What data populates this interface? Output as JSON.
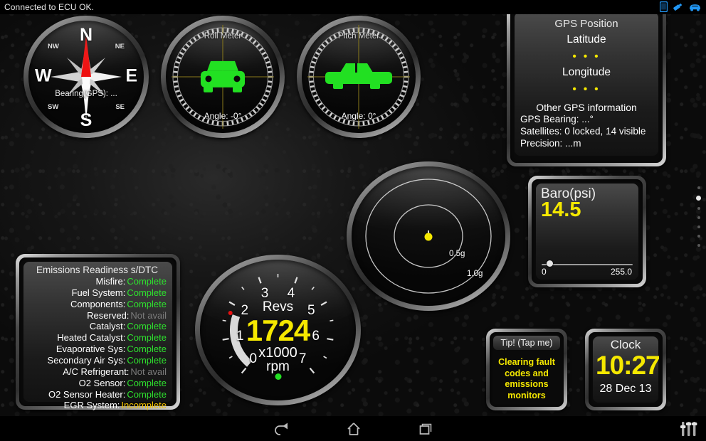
{
  "statusbar": {
    "message": "Connected to ECU OK.",
    "icons": [
      "tablet-icon",
      "usb-icon",
      "car-icon"
    ]
  },
  "compass": {
    "name": "Compass",
    "north": "N",
    "south": "S",
    "east": "E",
    "west": "W",
    "ne": "NE",
    "nw": "NW",
    "se": "SE",
    "sw": "SW",
    "bearing": "Bearing(GPS): ..."
  },
  "roll_meter": {
    "title": "Roll Meter",
    "angle": "Angle: -0°",
    "icon": "car-front-icon"
  },
  "pitch_meter": {
    "title": "Pitch Meter",
    "angle": "Angle: 0°",
    "icon": "car-side-icon"
  },
  "gps": {
    "title": "GPS Position",
    "latitude_label": "Latitude",
    "latitude_value": "• • •",
    "longitude_label": "Longitude",
    "longitude_value": "• • •",
    "other_title": "Other GPS information",
    "bearing": "GPS Bearing: ...°",
    "satellites": "Satellites: 0 locked, 14 visible",
    "precision": "Precision: ...m"
  },
  "baro": {
    "title": "Baro(psi)",
    "value": "14.5",
    "min": "0",
    "max": "255.0",
    "knob_percent": 5.7
  },
  "gmeter": {
    "name": "G-Force Meter",
    "ring_inner_label": "0.5g",
    "ring_outer_label": "1.0g"
  },
  "tacho": {
    "name": "Revs",
    "value": "1724",
    "unit_top": "x1000",
    "unit_bottom": "rpm",
    "ticks": [
      "0",
      "1",
      "2",
      "3",
      "4",
      "5",
      "6",
      "7"
    ],
    "arc_value": 1.724,
    "arc_max": 7
  },
  "emissions": {
    "title": "Emissions Readiness s/DTC",
    "rows": [
      {
        "key": "Misfire:",
        "value": "Complete",
        "state": "complete"
      },
      {
        "key": "Fuel System:",
        "value": "Complete",
        "state": "complete"
      },
      {
        "key": "Components:",
        "value": "Complete",
        "state": "complete"
      },
      {
        "key": "Reserved:",
        "value": "Not avail",
        "state": "notavail"
      },
      {
        "key": "Catalyst:",
        "value": "Complete",
        "state": "complete"
      },
      {
        "key": "Heated Catalyst:",
        "value": "Complete",
        "state": "complete"
      },
      {
        "key": "Evaporative Sys:",
        "value": "Complete",
        "state": "complete"
      },
      {
        "key": "Secondary Air Sys:",
        "value": "Complete",
        "state": "complete"
      },
      {
        "key": "A/C Refrigerant:",
        "value": "Not avail",
        "state": "notavail"
      },
      {
        "key": "O2 Sensor:",
        "value": "Complete",
        "state": "complete"
      },
      {
        "key": "O2 Sensor Heater:",
        "value": "Complete",
        "state": "complete"
      },
      {
        "key": "EGR System:",
        "value": "Incomplete",
        "state": "incomplete"
      }
    ]
  },
  "tip": {
    "header": "Tip! (Tap me)",
    "body": "Clearing fault codes and emissions monitors"
  },
  "clock": {
    "title": "Clock",
    "time": "10:27",
    "date": "28 Dec 13"
  },
  "pager": {
    "count": 7,
    "active_index": 1
  },
  "navbar": {
    "back": "back-icon",
    "home": "home-icon",
    "recents": "recents-icon",
    "settings": "equalizer-icon"
  },
  "colors": {
    "accent_yellow": "#f5e800",
    "green": "#2ee02e",
    "amber": "#f5c400",
    "grey": "#7b7b7b",
    "status_blue": "#2196f3"
  }
}
